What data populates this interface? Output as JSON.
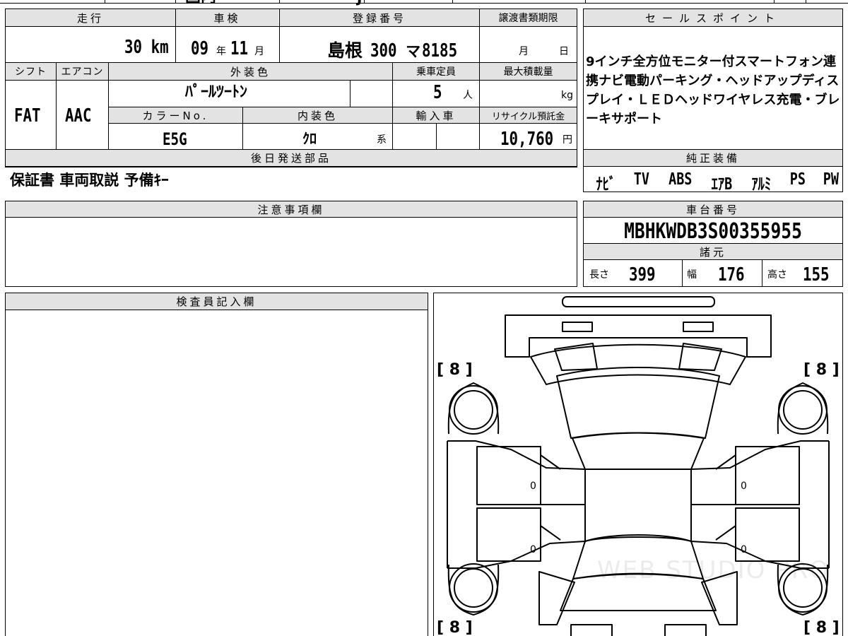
{
  "top_fragments": {
    "f1": "国内",
    "f2": "J"
  },
  "vehicle": {
    "mileage_header": "走行",
    "mileage_value": "30",
    "mileage_unit": "km",
    "shaken_header": "車検",
    "shaken_year": "09",
    "shaken_year_unit": "年",
    "shaken_month": "11",
    "shaken_month_unit": "月",
    "reg_header": "登録番号",
    "reg_region": "島根",
    "reg_class": "300",
    "reg_kana": "マ",
    "reg_number": "8185",
    "transfer_header": "譲渡書類期限",
    "transfer_month_unit": "月",
    "transfer_day_unit": "日",
    "shift_header": "シフト",
    "shift_value": "FAT",
    "ac_header": "エアコン",
    "ac_value": "AAC",
    "ext_color_header": "外装色",
    "ext_color_value": "ﾊﾟｰﾙﾂｰﾄﾝ",
    "capacity_header": "乗車定員",
    "capacity_value": "5",
    "capacity_unit": "人",
    "max_load_header": "最大積載量",
    "max_load_unit": "kg",
    "color_no_header": "カラーNo.",
    "color_no_value": "E5G",
    "int_color_header": "内装色",
    "int_color_value": "ｸﾛ",
    "int_color_suffix": "系",
    "import_header": "輸入車",
    "recycle_header": "リサイクル預託金",
    "recycle_value": "10,760",
    "recycle_unit": "円"
  },
  "delivery": {
    "header": "後日発送部品",
    "value": "保証書 車両取説 予備ｷｰ"
  },
  "sales_points": {
    "header": "セールスポイント",
    "text": "9インチ全方位モニター付スマートフォン連携ナビ電動パーキング・ヘッドアップディスプレイ・ＬＥＤヘッドワイヤレス充電・ブレーキサポート"
  },
  "standard_equipment": {
    "header": "純正装備",
    "items": [
      "ﾅﾋﾞ",
      "TV",
      "ABS",
      "ｴｱB",
      "ｱﾙﾐ",
      "PS",
      "PW"
    ]
  },
  "notes": {
    "header": "注意事項欄"
  },
  "chassis": {
    "header": "車台番号",
    "value": "MBHKWDB3S00355955"
  },
  "specs": {
    "header": "諸元",
    "length_label": "長さ",
    "length_value": "399",
    "width_label": "幅",
    "width_value": "176",
    "height_label": "高さ",
    "height_value": "155"
  },
  "inspector": {
    "header": "検査員記入欄"
  },
  "diagram": {
    "tire_fl": "[ 8 ]",
    "tire_fr": "[ 8 ]",
    "tire_rl": "[ 8 ]",
    "tire_rr": "[ 8 ]",
    "mark_left_front": "0",
    "mark_left_rear": "0",
    "mark_right_front": "0",
    "mark_right_rear": "0",
    "watermark": "WEB STUDIO PRO"
  }
}
